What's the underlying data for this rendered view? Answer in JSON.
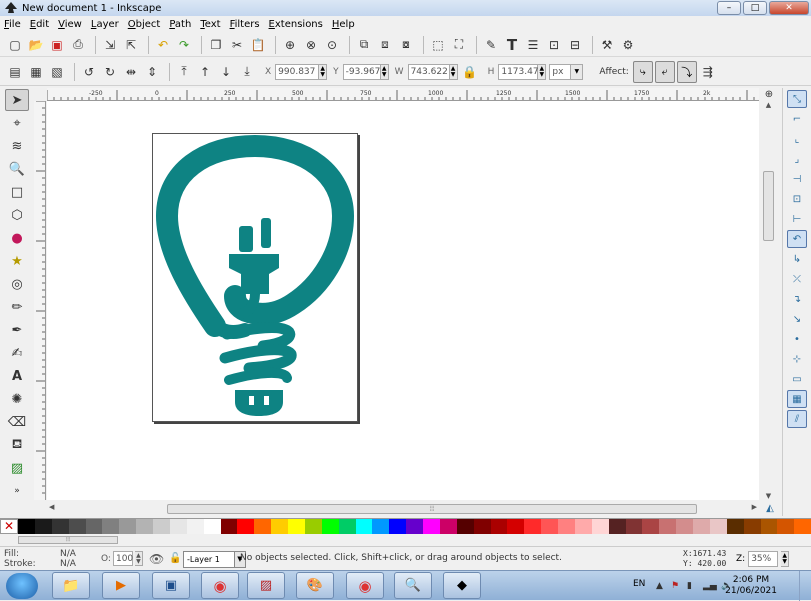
{
  "window": {
    "title": "New document 1 - Inkscape",
    "min": "–",
    "max": "□",
    "close": "✕"
  },
  "menu": [
    "File",
    "Edit",
    "View",
    "Layer",
    "Object",
    "Path",
    "Text",
    "Filters",
    "Extensions",
    "Help"
  ],
  "controls": {
    "x_label": "X",
    "x_value": "990.837",
    "y_label": "Y",
    "y_value": "-93.967",
    "w_label": "W",
    "w_value": "743.622",
    "h_label": "H",
    "h_value": "1173.47",
    "unit": "px",
    "affect_label": "Affect:"
  },
  "ruler": {
    "h_ticks": [
      "-250",
      "0",
      "250",
      "500",
      "750",
      "1000",
      "1250",
      "1500",
      "1750",
      "2k"
    ]
  },
  "colors": {
    "bulb": "#0e8383",
    "palette": [
      "#000000",
      "#1a1a1a",
      "#333333",
      "#4d4d4d",
      "#666666",
      "#808080",
      "#999999",
      "#b3b3b3",
      "#cccccc",
      "#e6e6e6",
      "#f2f2f2",
      "#ffffff",
      "#800000",
      "#ff0000",
      "#ff6600",
      "#ffcc00",
      "#ffff00",
      "#99cc00",
      "#00ff00",
      "#00cc66",
      "#00ffff",
      "#0099ff",
      "#0000ff",
      "#6600cc",
      "#ff00ff",
      "#cc0066",
      "#550000",
      "#800000",
      "#aa0000",
      "#d40000",
      "#ff2a2a",
      "#ff5555",
      "#ff8080",
      "#ffaaaa",
      "#ffd5d5",
      "#552222",
      "#803333",
      "#aa4444",
      "#c87171",
      "#d38d8d",
      "#deaaaa",
      "#e9c6c6",
      "#5a2d00",
      "#883c00",
      "#aa5500",
      "#d45500",
      "#ff6600"
    ]
  },
  "status": {
    "fill_label": "Fill:",
    "fill_value": "N/A",
    "stroke_label": "Stroke:",
    "stroke_value": "N/A",
    "opacity_label": "O:",
    "opacity_value": "100",
    "layer": "-Layer 1",
    "message": "No objects selected. Click, Shift+click, or drag around objects to select.",
    "x_coord": "X:1671.43",
    "y_coord": "Y:  420.00",
    "zoom_label": "Z:",
    "zoom_value": "35%"
  },
  "taskbar": {
    "lang": "EN",
    "time": "2:06 PM",
    "date": "21/06/2021"
  }
}
